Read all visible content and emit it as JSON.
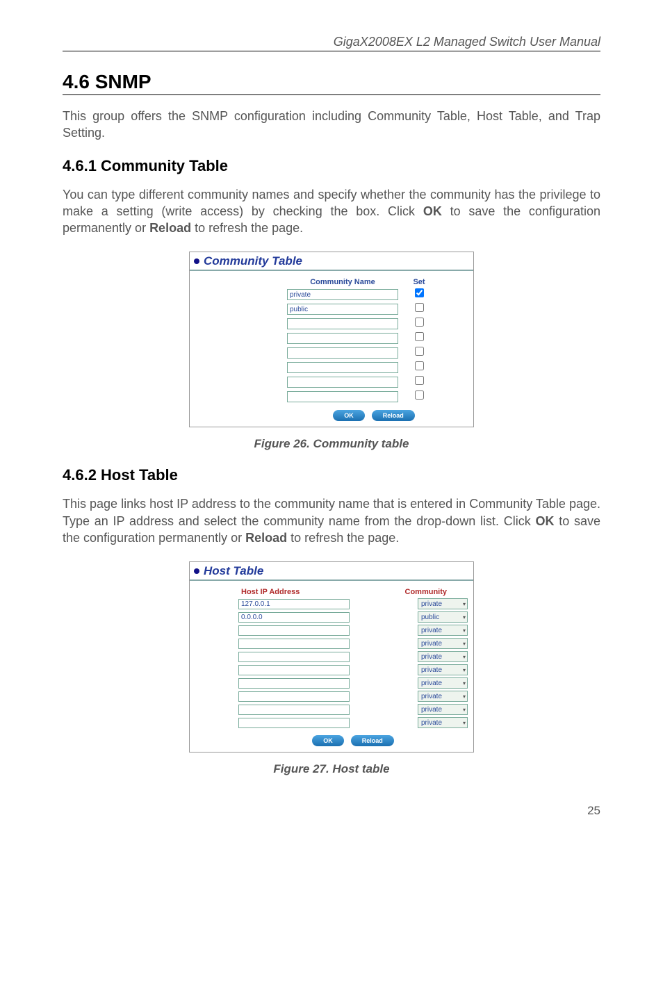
{
  "doc": {
    "title": "GigaX2008EX L2 Managed Switch User Manual",
    "page_number": "25"
  },
  "s46": {
    "heading": "4.6   SNMP",
    "para": "This group offers the SNMP configuration including Community Table, Host Table, and Trap Setting."
  },
  "s461": {
    "heading": "4.6.1  Community Table",
    "para_pre": "You can type different community names and specify whether the community has the privilege to make a setting (write access) by checking the box. Click ",
    "bold1": "OK",
    "para_mid": " to save the configuration permanently or ",
    "bold2": "Reload",
    "para_post": " to refresh the page."
  },
  "community_panel": {
    "title": "Community Table",
    "col_name": "Community Name",
    "col_set": "Set",
    "rows": [
      {
        "name": "private",
        "checked": true
      },
      {
        "name": "public",
        "checked": false
      },
      {
        "name": "",
        "checked": false
      },
      {
        "name": "",
        "checked": false
      },
      {
        "name": "",
        "checked": false
      },
      {
        "name": "",
        "checked": false
      },
      {
        "name": "",
        "checked": false
      },
      {
        "name": "",
        "checked": false
      }
    ],
    "ok": "OK",
    "reload": "Reload"
  },
  "fig26": "Figure 26. Community table",
  "s462": {
    "heading": " 4.6.2  Host Table",
    "para_pre": "This page links host IP address to the community name that is entered in Community Table page. Type an IP address and select the community name from the drop-down list. Click ",
    "bold1": "OK",
    "para_mid": " to save the configuration permanently or ",
    "bold2": "Reload",
    "para_post": " to refresh the page."
  },
  "host_panel": {
    "title": "Host Table",
    "col_ip": "Host IP Address",
    "col_com": "Community",
    "rows": [
      {
        "ip": "127.0.0.1",
        "comm": "private"
      },
      {
        "ip": "0.0.0.0",
        "comm": "public"
      },
      {
        "ip": "",
        "comm": "private"
      },
      {
        "ip": "",
        "comm": "private"
      },
      {
        "ip": "",
        "comm": "private"
      },
      {
        "ip": "",
        "comm": "private"
      },
      {
        "ip": "",
        "comm": "private"
      },
      {
        "ip": "",
        "comm": "private"
      },
      {
        "ip": "",
        "comm": "private"
      },
      {
        "ip": "",
        "comm": "private"
      }
    ],
    "ok": "OK",
    "reload": "Reload"
  },
  "fig27": "Figure 27. Host table"
}
